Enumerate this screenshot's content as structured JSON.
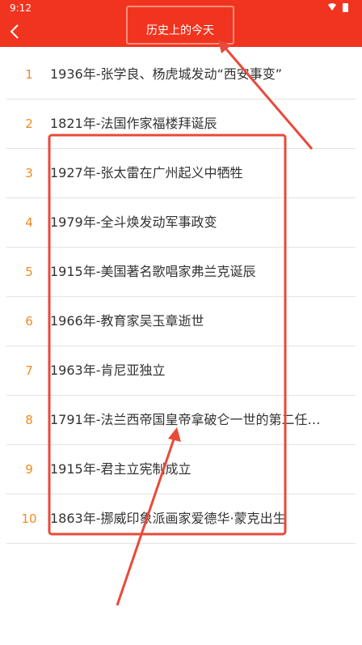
{
  "status": {
    "time": "9:12"
  },
  "header": {
    "title": "历史上的今天"
  },
  "events": [
    {
      "num": "1",
      "text": "1936年-张学良、杨虎城发动“西安事变”"
    },
    {
      "num": "2",
      "text": "1821年-法国作家福楼拜诞辰"
    },
    {
      "num": "3",
      "text": "1927年-张太雷在广州起义中牺牲"
    },
    {
      "num": "4",
      "text": "1979年-全斗焕发动军事政变"
    },
    {
      "num": "5",
      "text": "1915年-美国著名歌唱家弗兰克诞辰"
    },
    {
      "num": "6",
      "text": "1966年-教育家吴玉章逝世"
    },
    {
      "num": "7",
      "text": "1963年-肯尼亚独立"
    },
    {
      "num": "8",
      "text": "1791年-法兰西帝国皇帝拿破仑一世的第二任…"
    },
    {
      "num": "9",
      "text": "1915年-君主立宪制成立"
    },
    {
      "num": "10",
      "text": "1863年-挪威印象派画家爱德华·蒙克出生"
    }
  ],
  "colors": {
    "appbar": "#f1341f",
    "index_number": "#f08a20",
    "annotation": "#e84a3a"
  }
}
